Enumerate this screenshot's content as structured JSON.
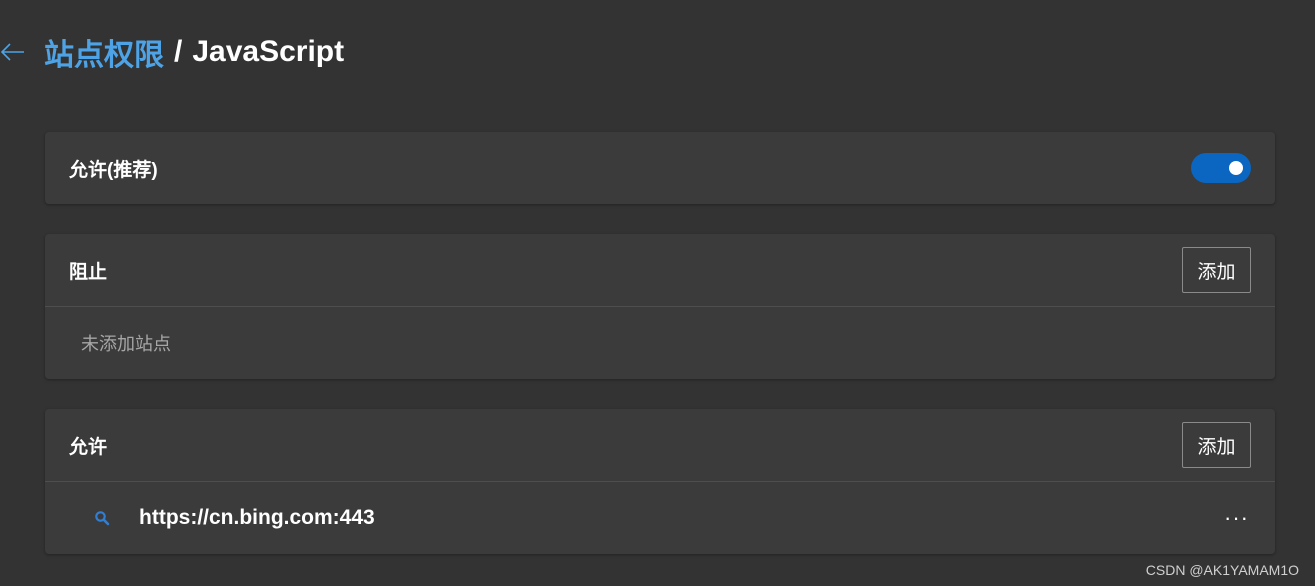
{
  "header": {
    "back_icon": "arrow-left-icon",
    "breadcrumb_parent": "站点权限",
    "separator": "/",
    "breadcrumb_current": "JavaScript"
  },
  "allowed_toggle": {
    "label": "允许(推荐)",
    "enabled": true,
    "accent": "#0a66c0"
  },
  "block_section": {
    "title": "阻止",
    "add_label": "添加",
    "empty_text": "未添加站点"
  },
  "allow_section": {
    "title": "允许",
    "add_label": "添加",
    "sites": [
      {
        "icon": "search-icon",
        "url": "https://cn.bing.com:443",
        "more": "···"
      }
    ]
  },
  "watermark": "CSDN @AK1YAMAM1O",
  "colors": {
    "background": "#333333",
    "card": "#3b3b3b",
    "link": "#4da3e6"
  }
}
